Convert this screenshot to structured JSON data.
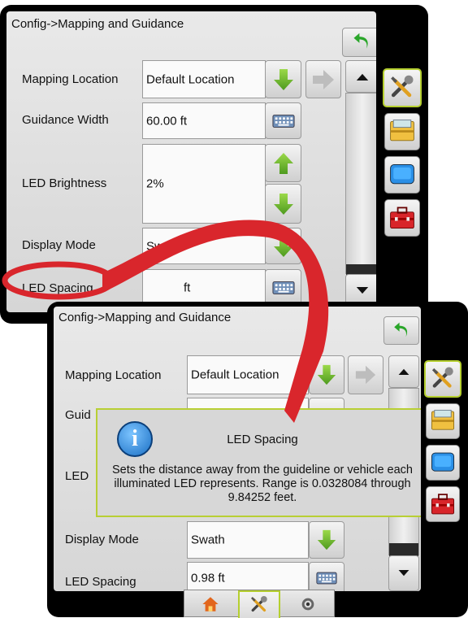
{
  "top": {
    "title": "Config->Mapping and Guidance",
    "rows": {
      "mapping_location": {
        "label": "Mapping Location",
        "value": "Default Location"
      },
      "guidance_width": {
        "label": "Guidance Width",
        "value": "60.00 ft"
      },
      "led_brightness": {
        "label": "LED Brightness",
        "value": "2%"
      },
      "display_mode": {
        "label": "Display Mode",
        "value": "Swath"
      },
      "led_spacing": {
        "label": "LED Spacing",
        "value": "0.98 ft",
        "visible_fragment": "ft"
      }
    }
  },
  "bottom": {
    "title": "Config->Mapping and Guidance",
    "rows": {
      "mapping_location": {
        "label": "Mapping Location",
        "value": "Default Location"
      },
      "guidance_width_fragment": "Guid",
      "led_brightness_fragment": "LED",
      "display_mode": {
        "label": "Display Mode",
        "value": "Swath"
      },
      "led_spacing": {
        "label": "LED Spacing",
        "value": "0.98 ft"
      }
    },
    "popup": {
      "title": "LED Spacing",
      "body": "Sets the distance away from the guideline or vehicle each illuminated LED represents. Range is 0.0328084 through 9.84252 feet."
    }
  },
  "icons": {
    "back": "back-arrow-icon",
    "down": "down-arrow-icon",
    "up": "up-arrow-icon",
    "right": "right-arrow-icon",
    "keyboard": "keyboard-icon",
    "tools": "tools-icon",
    "console": "console-icon",
    "display": "display-icon",
    "toolbox": "toolbox-icon",
    "home": "home-icon",
    "guidance": "guidance-icon"
  },
  "colors": {
    "highlight": "#b5cf2f",
    "arrow_green": "#6fba2c",
    "callout_red": "#d9262c",
    "popup_info": "#1e7fd8"
  }
}
